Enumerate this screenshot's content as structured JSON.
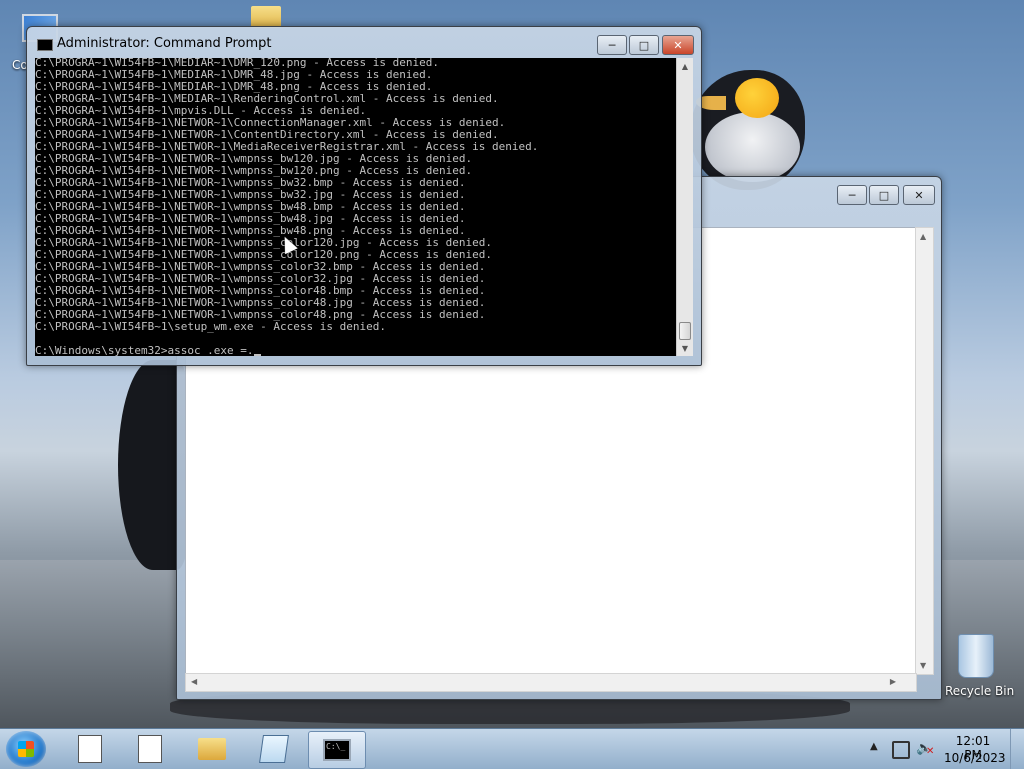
{
  "desktop": {
    "icons": [
      {
        "label": "Co"
      },
      {
        "label": "Recycle Bin"
      }
    ]
  },
  "cmd_window": {
    "title": "Administrator: Command Prompt",
    "lines": [
      "C:\\PROGRA~1\\WI54FB~1\\MEDIAR~1\\DMR_120.png - Access is denied.",
      "C:\\PROGRA~1\\WI54FB~1\\MEDIAR~1\\DMR_48.jpg - Access is denied.",
      "C:\\PROGRA~1\\WI54FB~1\\MEDIAR~1\\DMR_48.png - Access is denied.",
      "C:\\PROGRA~1\\WI54FB~1\\MEDIAR~1\\RenderingControl.xml - Access is denied.",
      "C:\\PROGRA~1\\WI54FB~1\\mpvis.DLL - Access is denied.",
      "C:\\PROGRA~1\\WI54FB~1\\NETWOR~1\\ConnectionManager.xml - Access is denied.",
      "C:\\PROGRA~1\\WI54FB~1\\NETWOR~1\\ContentDirectory.xml - Access is denied.",
      "C:\\PROGRA~1\\WI54FB~1\\NETWOR~1\\MediaReceiverRegistrar.xml - Access is denied.",
      "C:\\PROGRA~1\\WI54FB~1\\NETWOR~1\\wmpnss_bw120.jpg - Access is denied.",
      "C:\\PROGRA~1\\WI54FB~1\\NETWOR~1\\wmpnss_bw120.png - Access is denied.",
      "C:\\PROGRA~1\\WI54FB~1\\NETWOR~1\\wmpnss_bw32.bmp - Access is denied.",
      "C:\\PROGRA~1\\WI54FB~1\\NETWOR~1\\wmpnss_bw32.jpg - Access is denied.",
      "C:\\PROGRA~1\\WI54FB~1\\NETWOR~1\\wmpnss_bw48.bmp - Access is denied.",
      "C:\\PROGRA~1\\WI54FB~1\\NETWOR~1\\wmpnss_bw48.jpg - Access is denied.",
      "C:\\PROGRA~1\\WI54FB~1\\NETWOR~1\\wmpnss_bw48.png - Access is denied.",
      "C:\\PROGRA~1\\WI54FB~1\\NETWOR~1\\wmpnss_color120.jpg - Access is denied.",
      "C:\\PROGRA~1\\WI54FB~1\\NETWOR~1\\wmpnss_color120.png - Access is denied.",
      "C:\\PROGRA~1\\WI54FB~1\\NETWOR~1\\wmpnss_color32.bmp - Access is denied.",
      "C:\\PROGRA~1\\WI54FB~1\\NETWOR~1\\wmpnss_color32.jpg - Access is denied.",
      "C:\\PROGRA~1\\WI54FB~1\\NETWOR~1\\wmpnss_color48.bmp - Access is denied.",
      "C:\\PROGRA~1\\WI54FB~1\\NETWOR~1\\wmpnss_color48.jpg - Access is denied.",
      "C:\\PROGRA~1\\WI54FB~1\\NETWOR~1\\wmpnss_color48.png - Access is denied.",
      "C:\\PROGRA~1\\WI54FB~1\\setup_wm.exe - Access is denied."
    ],
    "prompt": "C:\\Windows\\system32>assoc .exe =."
  },
  "clock": {
    "time": "12:01 PM",
    "date": "10/6/2023"
  },
  "taskbar": {
    "prompt_icon_text": "C:\\_"
  }
}
